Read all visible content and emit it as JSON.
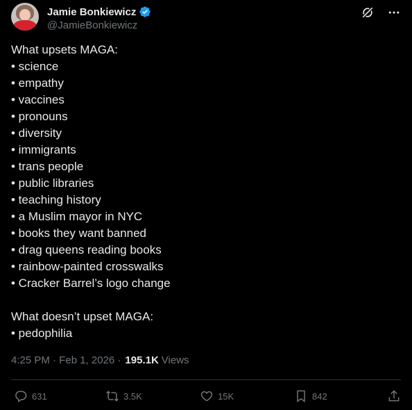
{
  "author": {
    "display_name": "Jamie Bonkiewicz",
    "handle": "@JamieBonkiewicz",
    "verified": true
  },
  "tweet": {
    "lines": [
      "What upsets MAGA:",
      "• science",
      "• empathy",
      "• vaccines",
      "• pronouns",
      "• diversity",
      "• immigrants",
      "• trans people",
      "• public libraries",
      "• teaching history",
      "• a Muslim mayor in NYC",
      "• books they want banned",
      "• drag queens reading books",
      "• rainbow-painted crosswalks",
      "• Cracker Barrel’s logo change",
      "",
      "What doesn’t upset MAGA:",
      "• pedophilia"
    ]
  },
  "meta": {
    "timestamp": "4:25 PM · Feb 1, 2026 ·",
    "views_count": "195.1K",
    "views_label": "Views"
  },
  "stats": {
    "replies": "631",
    "reposts": "3.5K",
    "likes": "15K",
    "bookmarks": "842"
  },
  "colors": {
    "background": "#000000",
    "text": "#e7e9ea",
    "secondary": "#71767b",
    "verified": "#1d9bf0",
    "divider": "#2f3336"
  },
  "icons": [
    "verified-badge-icon",
    "grok-icon",
    "more-icon",
    "reply-icon",
    "repost-icon",
    "like-icon",
    "bookmark-icon",
    "share-icon"
  ]
}
